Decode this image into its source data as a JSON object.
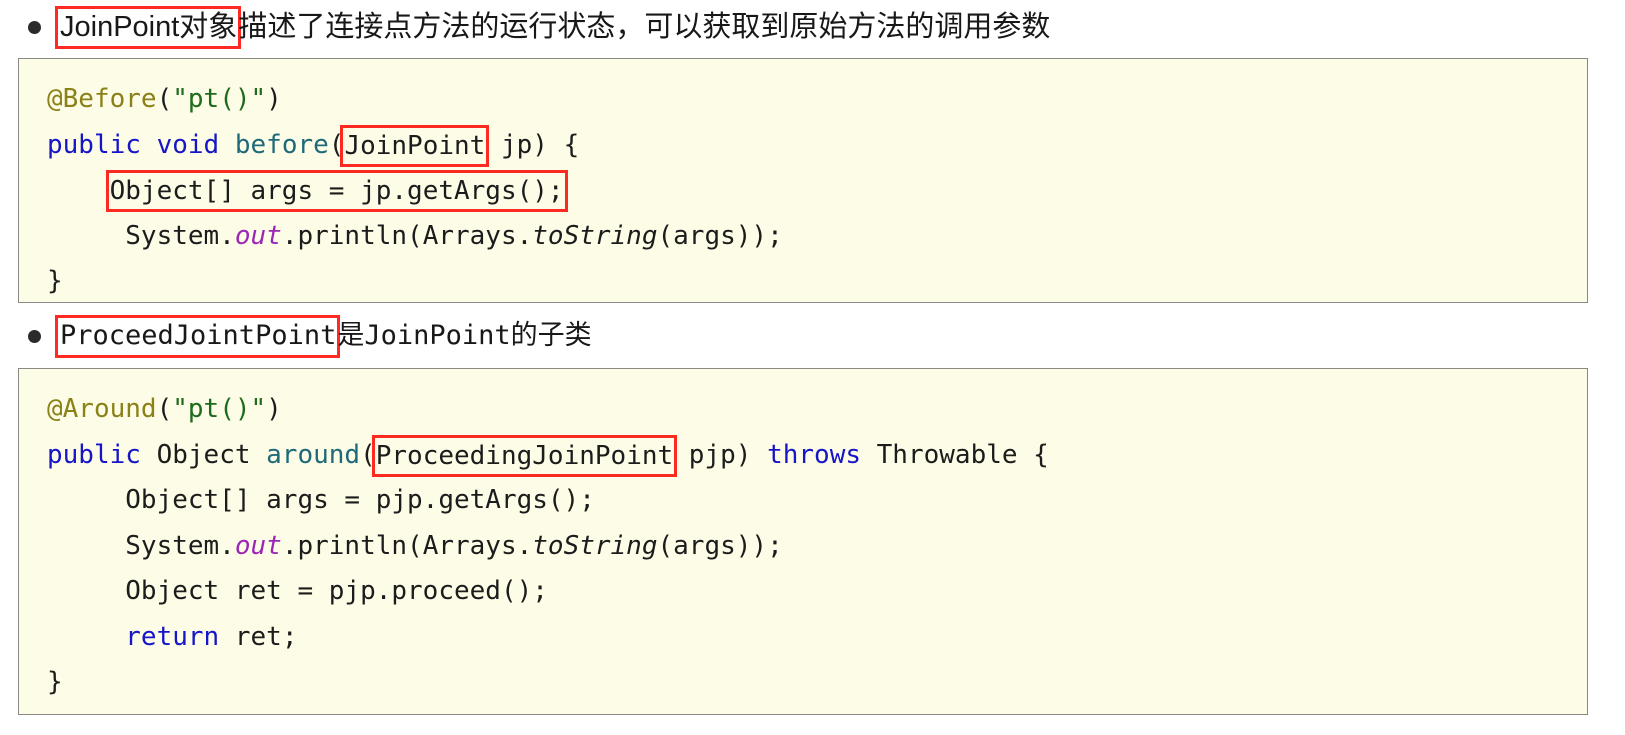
{
  "document": {
    "bullets": [
      {
        "id": "bullet-joinpoint",
        "highlighted_text": "JoinPoint对象",
        "rest_text": "描述了连接点方法的运行状态，可以获取到原始方法的调用参数",
        "font": "sans"
      },
      {
        "id": "bullet-proceedjointpoint",
        "highlighted_text": "ProceedJointPoint",
        "rest_text": "是JoinPoint的子类",
        "font": "mono"
      }
    ],
    "code_blocks": [
      {
        "id": "code-block-before",
        "language": "java",
        "lines": [
          {
            "id": "line-before-annotation",
            "tokens": [
              {
                "text": "@Before",
                "style": "anno"
              },
              {
                "text": "(",
                "style": "plain"
              },
              {
                "text": "\"pt()\"",
                "style": "str"
              },
              {
                "text": ")",
                "style": "plain"
              }
            ]
          },
          {
            "id": "line-before-signature",
            "tokens": [
              {
                "text": "public",
                "style": "kw"
              },
              {
                "text": " ",
                "style": "plain"
              },
              {
                "text": "void",
                "style": "kw"
              },
              {
                "text": " ",
                "style": "plain"
              },
              {
                "text": "before",
                "style": "meth"
              },
              {
                "text": "(",
                "style": "plain"
              },
              {
                "text": "JoinPoint",
                "style": "plain",
                "highlight": true
              },
              {
                "text": " jp) {",
                "style": "plain"
              }
            ]
          },
          {
            "id": "line-before-getargs",
            "indent": 4,
            "tokens": [
              {
                "text": "Object[] args = jp.getArgs();",
                "style": "plain",
                "highlight": true
              }
            ]
          },
          {
            "id": "line-before-println",
            "indent": 4,
            "tokens": [
              {
                "text": "System.",
                "style": "plain"
              },
              {
                "text": "out",
                "style": "field"
              },
              {
                "text": ".println(Arrays.",
                "style": "plain"
              },
              {
                "text": "toString",
                "style": "static"
              },
              {
                "text": "(args));",
                "style": "plain"
              }
            ]
          },
          {
            "id": "line-before-close",
            "tokens": [
              {
                "text": "}",
                "style": "plain"
              }
            ]
          }
        ]
      },
      {
        "id": "code-block-around",
        "language": "java",
        "lines": [
          {
            "id": "line-around-annotation",
            "tokens": [
              {
                "text": "@Around",
                "style": "anno"
              },
              {
                "text": "(",
                "style": "plain"
              },
              {
                "text": "\"pt()\"",
                "style": "str"
              },
              {
                "text": ")",
                "style": "plain"
              }
            ]
          },
          {
            "id": "line-around-signature",
            "tokens": [
              {
                "text": "public",
                "style": "kw"
              },
              {
                "text": " Object ",
                "style": "plain"
              },
              {
                "text": "around",
                "style": "meth"
              },
              {
                "text": "(",
                "style": "plain"
              },
              {
                "text": "ProceedingJoinPoint",
                "style": "plain",
                "highlight": true
              },
              {
                "text": " pjp) ",
                "style": "plain"
              },
              {
                "text": "throws",
                "style": "kw"
              },
              {
                "text": " Throwable {",
                "style": "plain"
              }
            ]
          },
          {
            "id": "line-around-getargs",
            "indent": 4,
            "tokens": [
              {
                "text": "Object[] args = pjp.getArgs();",
                "style": "plain"
              }
            ]
          },
          {
            "id": "line-around-println",
            "indent": 4,
            "tokens": [
              {
                "text": "System.",
                "style": "plain"
              },
              {
                "text": "out",
                "style": "field"
              },
              {
                "text": ".println(Arrays.",
                "style": "plain"
              },
              {
                "text": "toString",
                "style": "static"
              },
              {
                "text": "(args));",
                "style": "plain"
              }
            ]
          },
          {
            "id": "line-around-proceed",
            "indent": 4,
            "tokens": [
              {
                "text": "Object ret = pjp.proceed();",
                "style": "plain"
              }
            ]
          },
          {
            "id": "line-around-return",
            "indent": 4,
            "tokens": [
              {
                "text": "return",
                "style": "kw"
              },
              {
                "text": " ret;",
                "style": "plain"
              }
            ]
          },
          {
            "id": "line-around-close",
            "tokens": [
              {
                "text": "}",
                "style": "plain"
              }
            ]
          }
        ]
      }
    ],
    "colors": {
      "code_background": "#fdfce6",
      "code_border": "#8a8a82",
      "highlight_box": "#fc2a20",
      "keyword": "#1616c8",
      "annotation": "#8a8118",
      "string": "#1d6b1d",
      "method": "#1e6a7a",
      "field": "#9b26b6",
      "text": "#1c1c1c"
    }
  }
}
